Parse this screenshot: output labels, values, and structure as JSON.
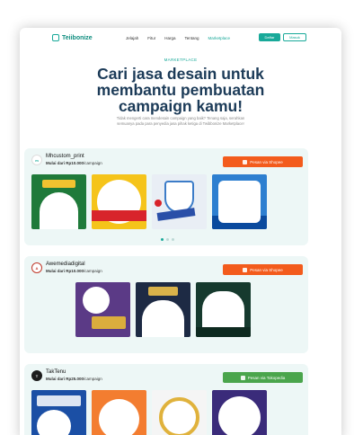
{
  "header": {
    "logo": "Teiibonize",
    "nav": [
      "Jelajah",
      "Fitur",
      "Harga",
      "Tentang",
      "Marketplace"
    ],
    "masuk": "Daftar",
    "daftar": "Masuk"
  },
  "hero": {
    "tag": "MARKETPLACE",
    "title": "Cari jasa desain untuk membantu pembuatan campaign kamu!",
    "subtitle": "Tidak mengerti cara mendesain campaign yang baik? Tenang saja, serahkan semuanya pada para penyedia jasa pihak ketiga di Twibbonize Marketplace!"
  },
  "vendors": [
    {
      "name": "Mhcustom_print",
      "price_bold": "Mulai dari Rp10.000",
      "price_suffix": "/campaign",
      "order_label": "Pesan via Shopee"
    },
    {
      "name": "Awemediadigital",
      "price_bold": "Mulai dari Rp10.000",
      "price_suffix": "/campaign",
      "order_label": "Pesan via Shopee"
    },
    {
      "name": "TakTenu",
      "price_bold": "Mulai dari Rp25.000",
      "price_suffix": "/campaign",
      "order_label": "Pesan via Tokopedia"
    }
  ],
  "colors": {
    "accent": "#18a999",
    "shopee": "#f35b1c",
    "tokopedia": "#4aa54c",
    "card_bg": "#edf7f6"
  }
}
